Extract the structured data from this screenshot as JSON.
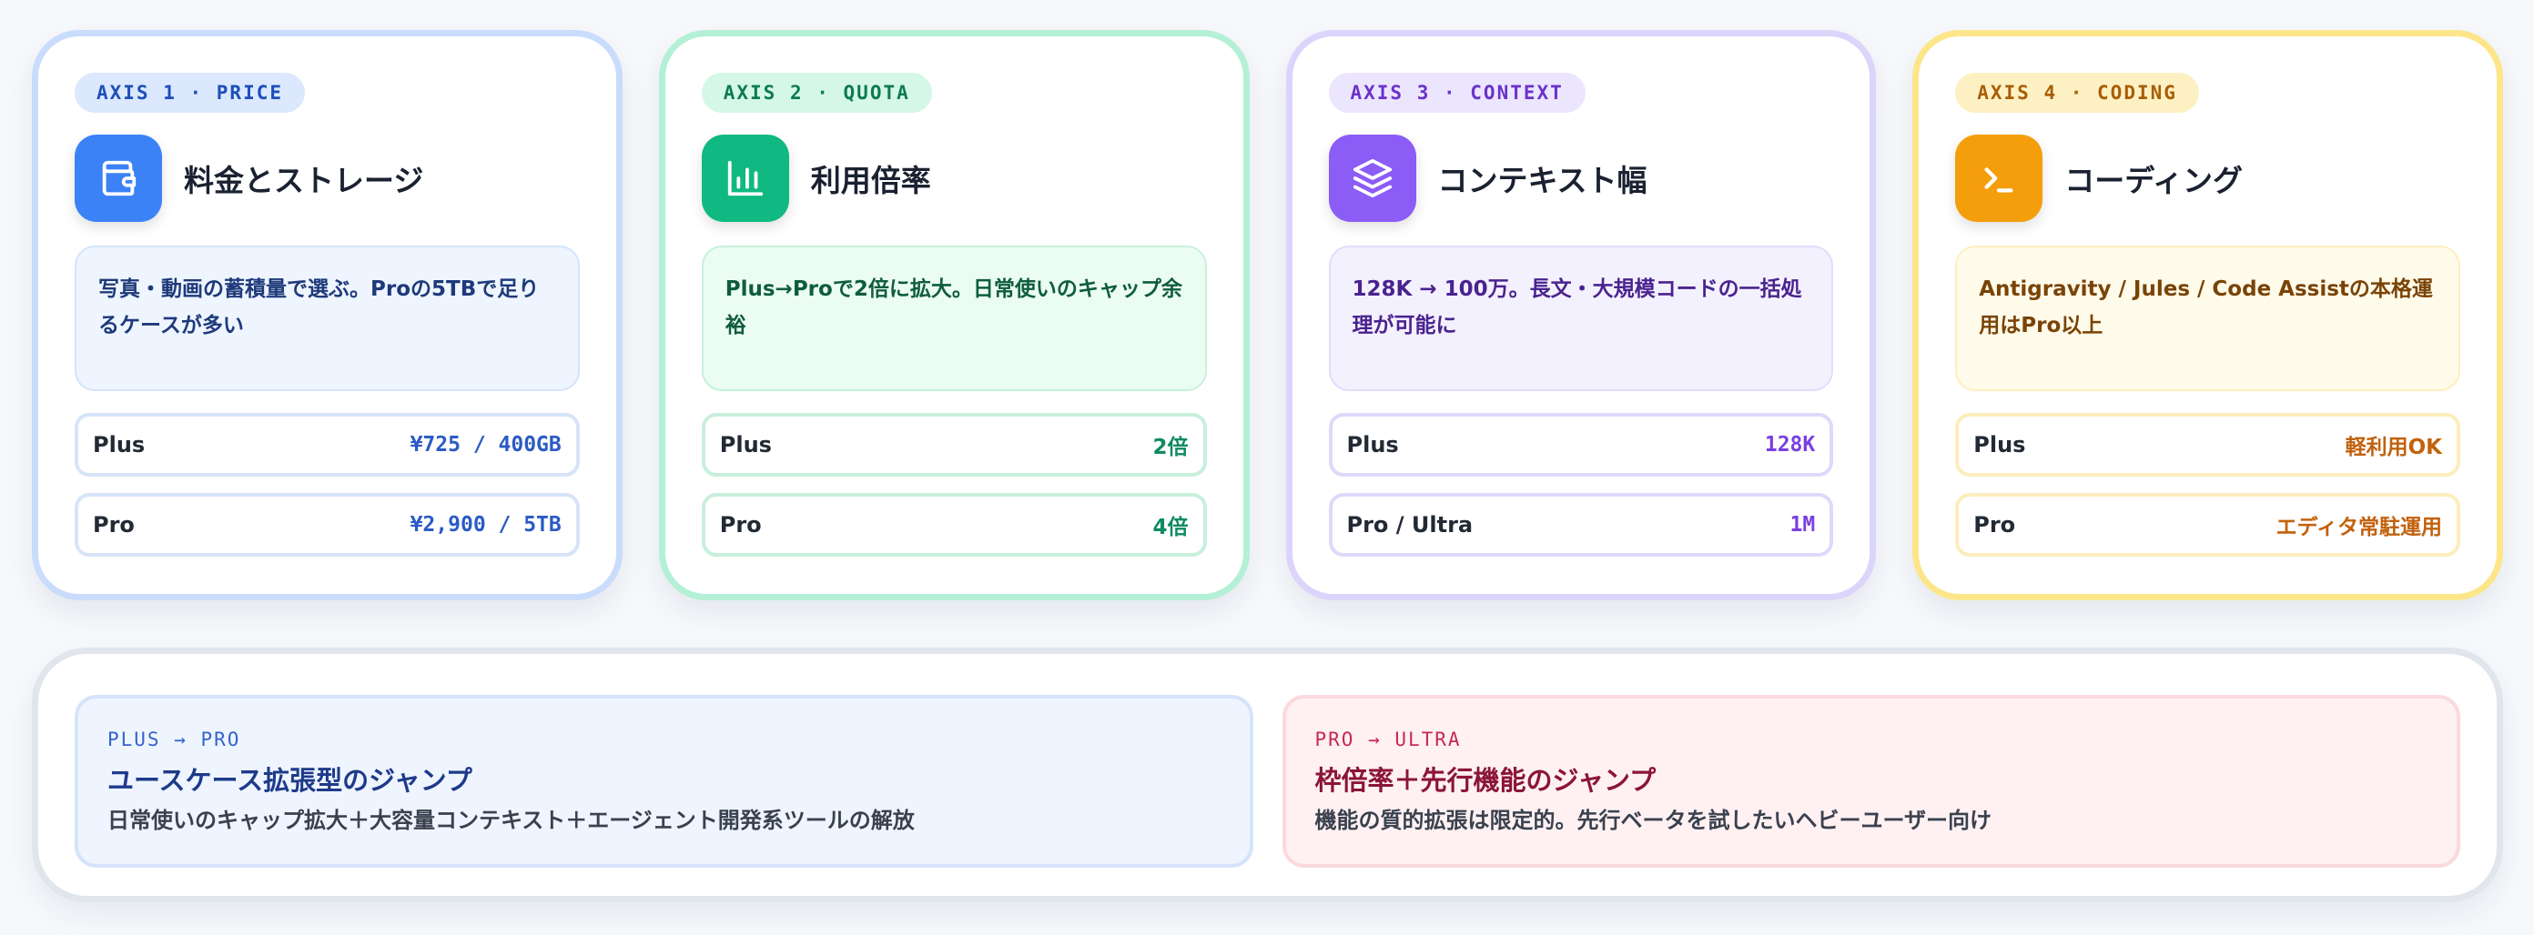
{
  "cards": [
    {
      "axis": "AXIS 1 · PRICE",
      "title": "料金とストレージ",
      "icon": "wallet-icon",
      "description": "写真・動画の蓄積量で選ぶ。Proの5TBで足りるケースが多い",
      "rows": [
        {
          "label": "Plus",
          "value": "¥725 / 400GB"
        },
        {
          "label": "Pro",
          "value": "¥2,900 / 5TB"
        }
      ],
      "accent": "#3b82f6"
    },
    {
      "axis": "AXIS 2 · QUOTA",
      "title": "利用倍率",
      "icon": "bar-chart-icon",
      "description": "Plus→Proで2倍に拡大。日常使いのキャップ余裕",
      "rows": [
        {
          "label": "Plus",
          "value": "2倍"
        },
        {
          "label": "Pro",
          "value": "4倍"
        }
      ],
      "accent": "#10b981"
    },
    {
      "axis": "AXIS 3 · CONTEXT",
      "title": "コンテキスト幅",
      "icon": "layers-icon",
      "description": "128K → 100万。長文・大規模コードの一括処理が可能に",
      "rows": [
        {
          "label": "Plus",
          "value": "128K"
        },
        {
          "label": "Pro / Ultra",
          "value": "1M"
        }
      ],
      "accent": "#8b5cf6"
    },
    {
      "axis": "AXIS 4 · CODING",
      "title": "コーディング",
      "icon": "terminal-icon",
      "description": "Antigravity / Jules / Code Assistの本格運用はPro以上",
      "rows": [
        {
          "label": "Plus",
          "value": "軽利用OK"
        },
        {
          "label": "Pro",
          "value": "エディタ常駐運用"
        }
      ],
      "accent": "#f59e0b"
    }
  ],
  "jumps": [
    {
      "eyebrow": "PLUS → PRO",
      "title": "ユースケース拡張型のジャンプ",
      "description": "日常使いのキャップ拡大＋大容量コンテキスト＋エージェント開発系ツールの解放"
    },
    {
      "eyebrow": "PRO → ULTRA",
      "title": "枠倍率＋先行機能のジャンプ",
      "description": "機能の質的拡張は限定的。先行ベータを試したいヘビーユーザー向け"
    }
  ]
}
